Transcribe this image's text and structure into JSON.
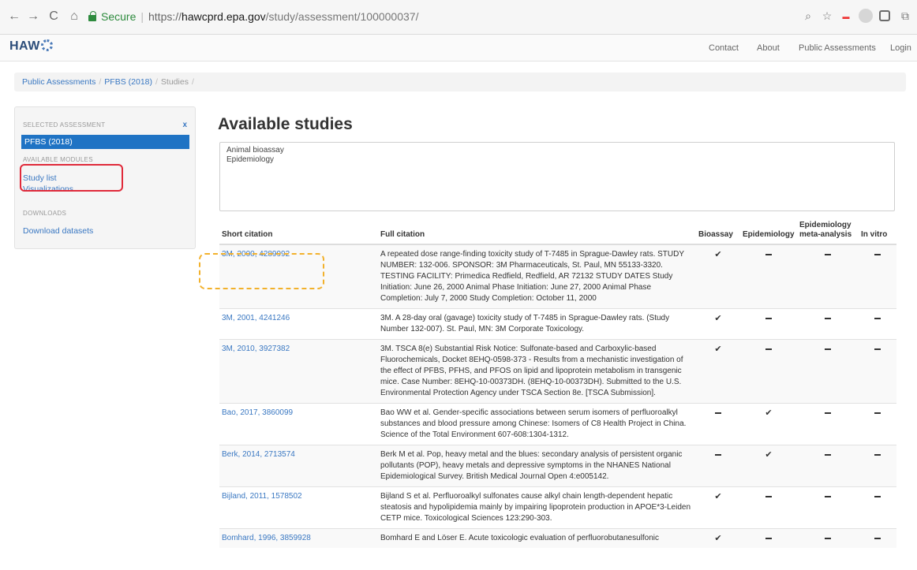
{
  "browser": {
    "secure_label": "Secure",
    "url_scheme": "https://",
    "url_host": "hawcprd.epa.gov",
    "url_path": "/study/assessment/100000037/"
  },
  "appbar": {
    "logo": "HAWC",
    "links": [
      "Contact",
      "About",
      "Public Assessments",
      "Login"
    ]
  },
  "breadcrumb": {
    "items": [
      "Public Assessments",
      "PFBS (2018)"
    ],
    "current": "Studies"
  },
  "sidebar": {
    "selected_header": "SELECTED ASSESSMENT",
    "close": "x",
    "selected": "PFBS (2018)",
    "modules_header": "AVAILABLE MODULES",
    "modules": [
      "Study list",
      "Visualizations"
    ],
    "downloads_header": "DOWNLOADS",
    "downloads": [
      "Download datasets"
    ]
  },
  "main": {
    "title": "Available studies",
    "study_types": [
      "Animal bioassay",
      "Epidemiology"
    ],
    "table": {
      "headers": [
        "Short citation",
        "Full citation",
        "Bioassay",
        "Epidemiology",
        "Epidemiology meta-analysis",
        "In vitro"
      ],
      "rows": [
        {
          "short": "3M, 2000, 4289992",
          "full": "A repeated dose range-finding toxicity study of T-7485 in Sprague-Dawley rats. STUDY NUMBER: 132-006. SPONSOR: 3M Pharmaceuticals, St. Paul, MN 55133-3320. TESTING FACILITY: Primedica Redfield, Redfield, AR 72132 STUDY DATES Study Initiation: June 26, 2000 Animal Phase Initiation: June 27, 2000 Animal Phase Completion: July 7, 2000 Study Completion: October 11, 2000",
          "flags": [
            true,
            false,
            false,
            false
          ]
        },
        {
          "short": "3M, 2001, 4241246",
          "full": "3M. A 28-day oral (gavage) toxicity study of T-7485 in Sprague-Dawley rats. (Study Number 132-007). St. Paul, MN: 3M Corporate Toxicology.",
          "flags": [
            true,
            false,
            false,
            false
          ]
        },
        {
          "short": "3M, 2010, 3927382",
          "full": "3M. TSCA 8(e) Substantial Risk Notice: Sulfonate-based and Carboxylic-based Fluorochemicals, Docket 8EHQ-0598-373 - Results from a mechanistic investigation of the effect of PFBS, PFHS, and PFOS on lipid and lipoprotein metabolism in transgenic mice. Case Number: 8EHQ-10-00373DH. (8EHQ-10-00373DH). Submitted to the U.S. Environmental Protection Agency under TSCA Section 8e. [TSCA Submission].",
          "flags": [
            true,
            false,
            false,
            false
          ]
        },
        {
          "short": "Bao, 2017, 3860099",
          "full": "Bao WW et al. Gender-specific associations between serum isomers of perfluoroalkyl substances and blood pressure among Chinese: Isomers of C8 Health Project in China. Science of the Total Environment 607-608:1304-1312.",
          "flags": [
            false,
            true,
            false,
            false
          ]
        },
        {
          "short": "Berk, 2014, 2713574",
          "full": "Berk M et al. Pop, heavy metal and the blues: secondary analysis of persistent organic pollutants (POP), heavy metals and depressive symptoms in the NHANES National Epidemiological Survey. British Medical Journal Open 4:e005142.",
          "flags": [
            false,
            true,
            false,
            false
          ]
        },
        {
          "short": "Bijland, 2011, 1578502",
          "full": "Bijland S et al. Perfluoroalkyl sulfonates cause alkyl chain length-dependent hepatic steatosis and hypolipidemia mainly by impairing lipoprotein production in APOE*3-Leiden CETP mice. Toxicological Sciences 123:290-303.",
          "flags": [
            true,
            false,
            false,
            false
          ]
        },
        {
          "short": "Bomhard, 1996, 3859928",
          "full": "Bomhard E and Löser E. Acute toxicologic evaluation of perfluorobutanesulfonic",
          "flags": [
            true,
            false,
            false,
            false
          ]
        }
      ]
    }
  }
}
